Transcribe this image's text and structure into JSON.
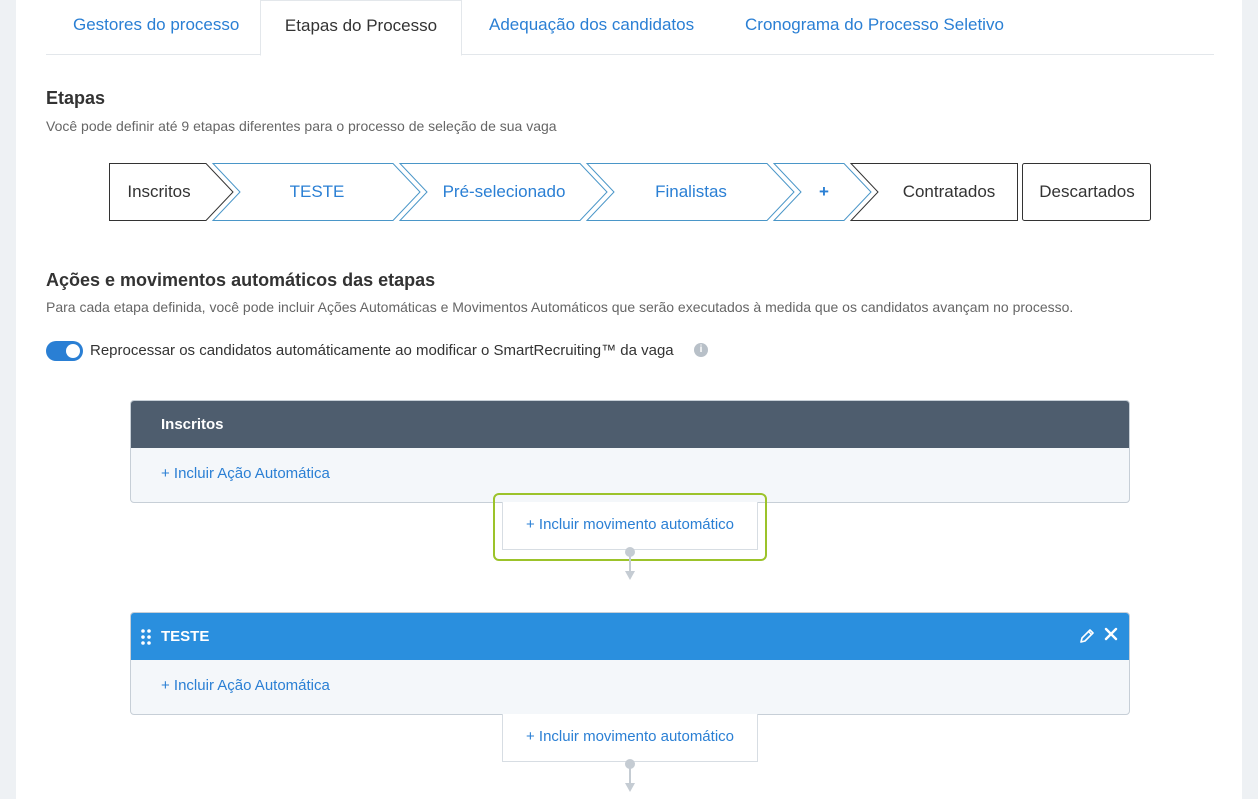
{
  "tabs": [
    "Gestores do processo",
    "Etapas do Processo",
    "Adequação dos candidatos",
    "Cronograma do Processo Seletivo"
  ],
  "active_tab": "Etapas do Processo",
  "etapas": {
    "title": "Etapas",
    "subtitle": "Você pode definir até 9 etapas diferentes para o processo de seleção de sua vaga",
    "stages": [
      "Inscritos",
      "TESTE",
      "Pré-selecionado",
      "Finalistas",
      "+",
      "Contratados",
      "Descartados"
    ]
  },
  "acoes": {
    "title": "Ações e movimentos automáticos das etapas",
    "subtitle": "Para cada etapa definida, você pode incluir Ações Automáticas e Movimentos Automáticos que serão executados à medida que os candidatos avançam no processo.",
    "toggle_label": "Reprocessar os candidatos automáticamente ao modificar o SmartRecruiting™ da vaga",
    "toggle_on": true,
    "info_icon": "i"
  },
  "cards": [
    {
      "name": "Inscritos",
      "action": "+ Incluir Ação Automática",
      "move": "+ Incluir movimento automático"
    },
    {
      "name": "TESTE",
      "action": "+ Incluir Ação Automática",
      "move": "+ Incluir movimento automático"
    }
  ],
  "colors": {
    "accent": "#2a7fd4",
    "header_gray": "#4e5d6e",
    "header_blue": "#2a8fde",
    "highlight": "#9cc32a"
  }
}
